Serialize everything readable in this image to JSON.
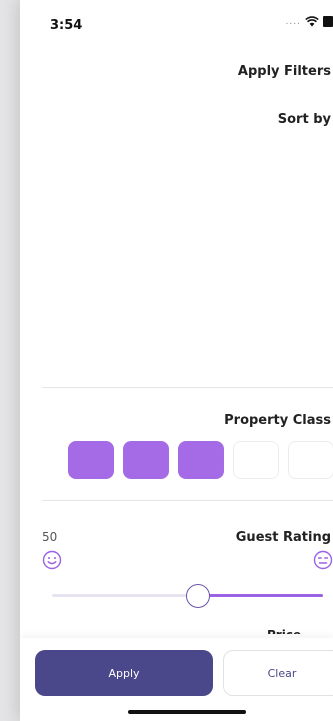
{
  "status_bar": {
    "time": "3:54",
    "signal": "....",
    "wifi_icon": "wifi-icon",
    "battery_icon": "battery-icon"
  },
  "header": {
    "title": "Apply Filters"
  },
  "sort": {
    "title": "Sort by"
  },
  "property_class": {
    "title": "Property Class",
    "selected_count": 3,
    "total_count": 5
  },
  "guest_rating": {
    "title": "Guest Rating",
    "value": "50",
    "min_icon": "smile-face-icon",
    "max_icon": "neutral-face-icon",
    "slider_value": 0.5
  },
  "actions": {
    "apply_label": "Apply",
    "clear_label": "Clear"
  },
  "colors": {
    "accent": "#a56ae6",
    "primary_button": "#4a478a",
    "slider_fill": "#9b62e6"
  }
}
